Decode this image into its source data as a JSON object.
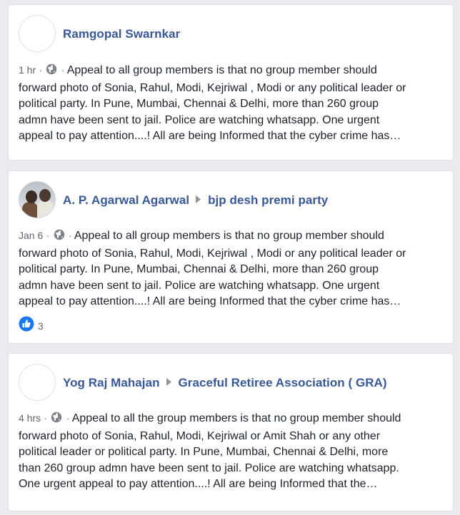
{
  "posts": [
    {
      "author": "Ramgopal Swarnkar",
      "group": "",
      "time": "1 hr",
      "separator": "·",
      "lines": [
        "Appeal to all group members is that no group member should",
        "forward photo of Sonia, Rahul, Modi, Kejriwal , Modi or any political leader or",
        "political party. In Pune, Mumbai, Chennai & Delhi, more than 260 group",
        "admn have been sent to jail. Police are watching whatsapp. One urgent",
        "appeal to pay attention....! All are being Informed that the cyber crime has…"
      ]
    },
    {
      "author": "A. P. Agarwal Agarwal",
      "group": "bjp desh premi party",
      "time": "Jan 6",
      "separator": "·",
      "lines": [
        "Appeal to all group members is that no group member should",
        "forward photo of Sonia, Rahul, Modi, Kejriwal , Modi or any political leader or",
        "political party. In Pune, Mumbai, Chennai & Delhi, more than 260 group",
        "admn have been sent to jail. Police are watching whatsapp. One urgent",
        "appeal to pay attention....! All are being Informed that the cyber crime has…"
      ],
      "reactions": "3"
    },
    {
      "author": "Yog Raj Mahajan",
      "group": "Graceful Retiree Association ( GRA)",
      "time": "4 hrs",
      "separator": "·",
      "lines": [
        "Appeal to all the group members is that no group member should",
        "forward photo of Sonia, Rahul, Modi, Kejriwal or Amit Shah or any other",
        "political leader or political party. In Pune, Mumbai, Chennai & Delhi, more",
        "than 260 group admn have been sent to jail. Police are watching whatsapp.",
        "One urgent appeal to pay attention....! All are being Informed that the…"
      ]
    }
  ],
  "icons": {
    "privacy": "globe-icon",
    "arrow": "caret-right-icon",
    "reaction": "like-icon"
  },
  "colors": {
    "link": "#385898",
    "meta": "#616770",
    "text": "#1d2129",
    "background": "#e9ebee",
    "like": "#1877f2"
  }
}
